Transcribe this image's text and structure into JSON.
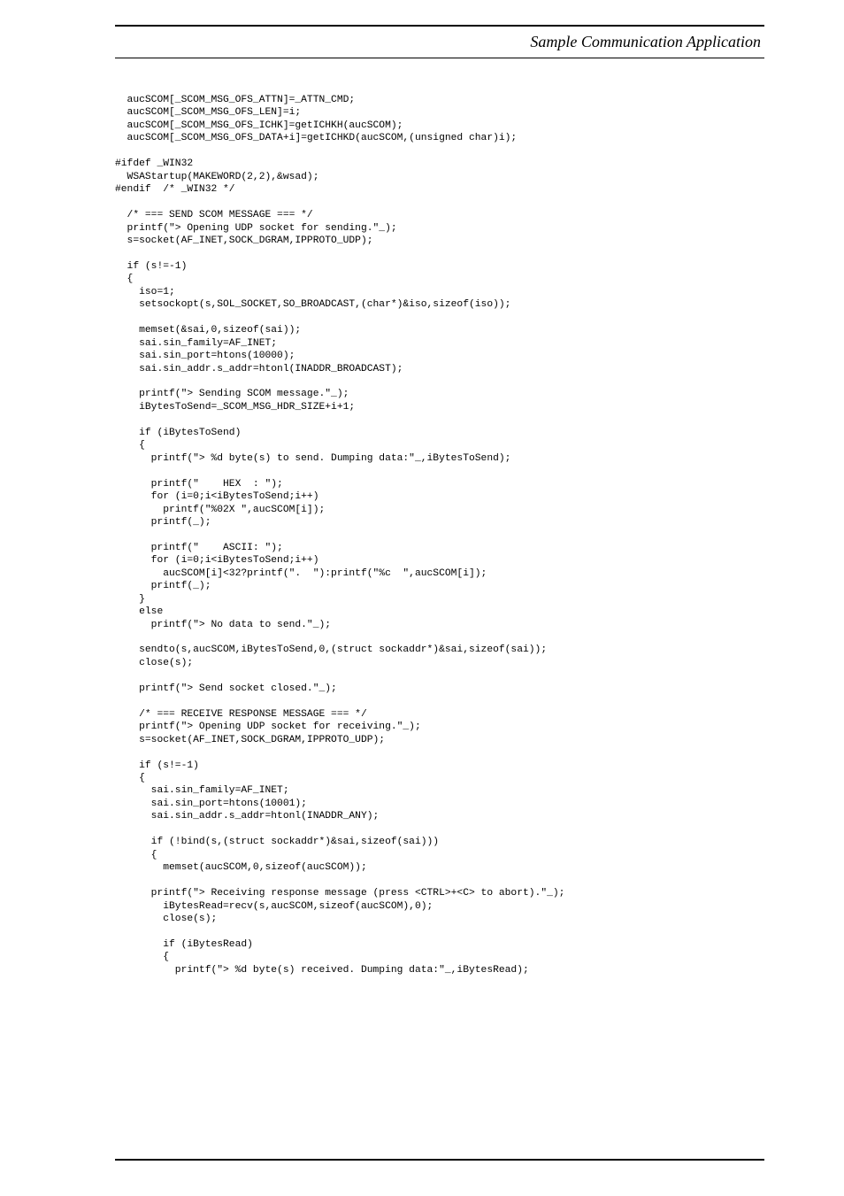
{
  "header": {
    "title": "Sample Communication Application"
  },
  "code": "  aucSCOM[_SCOM_MSG_OFS_ATTN]=_ATTN_CMD;\n  aucSCOM[_SCOM_MSG_OFS_LEN]=i;\n  aucSCOM[_SCOM_MSG_OFS_ICHK]=getICHKH(aucSCOM);\n  aucSCOM[_SCOM_MSG_OFS_DATA+i]=getICHKD(aucSCOM,(unsigned char)i);\n\n#ifdef _WIN32\n  WSAStartup(MAKEWORD(2,2),&wsad);\n#endif  /* _WIN32 */\n\n  /* === SEND SCOM MESSAGE === */\n  printf(\"> Opening UDP socket for sending.\"_);\n  s=socket(AF_INET,SOCK_DGRAM,IPPROTO_UDP);\n\n  if (s!=-1)\n  {\n    iso=1;\n    setsockopt(s,SOL_SOCKET,SO_BROADCAST,(char*)&iso,sizeof(iso));\n\n    memset(&sai,0,sizeof(sai));\n    sai.sin_family=AF_INET;\n    sai.sin_port=htons(10000);\n    sai.sin_addr.s_addr=htonl(INADDR_BROADCAST);\n\n    printf(\"> Sending SCOM message.\"_);\n    iBytesToSend=_SCOM_MSG_HDR_SIZE+i+1;\n\n    if (iBytesToSend)\n    {\n      printf(\"> %d byte(s) to send. Dumping data:\"_,iBytesToSend);\n\n      printf(\"    HEX  : \");\n      for (i=0;i<iBytesToSend;i++)\n        printf(\"%02X \",aucSCOM[i]);\n      printf(_);\n\n      printf(\"    ASCII: \");\n      for (i=0;i<iBytesToSend;i++)\n        aucSCOM[i]<32?printf(\".  \"):printf(\"%c  \",aucSCOM[i]);\n      printf(_);\n    }\n    else\n      printf(\"> No data to send.\"_);\n\n    sendto(s,aucSCOM,iBytesToSend,0,(struct sockaddr*)&sai,sizeof(sai));\n    close(s);\n\n    printf(\"> Send socket closed.\"_);\n\n    /* === RECEIVE RESPONSE MESSAGE === */\n    printf(\"> Opening UDP socket for receiving.\"_);\n    s=socket(AF_INET,SOCK_DGRAM,IPPROTO_UDP);\n\n    if (s!=-1)\n    {\n      sai.sin_family=AF_INET;\n      sai.sin_port=htons(10001);\n      sai.sin_addr.s_addr=htonl(INADDR_ANY);\n\n      if (!bind(s,(struct sockaddr*)&sai,sizeof(sai)))\n      {\n        memset(aucSCOM,0,sizeof(aucSCOM));\n\n      printf(\"> Receiving response message (press <CTRL>+<C> to abort).\"_);\n        iBytesRead=recv(s,aucSCOM,sizeof(aucSCOM),0);\n        close(s);\n\n        if (iBytesRead)\n        {\n          printf(\"> %d byte(s) received. Dumping data:\"_,iBytesRead);"
}
